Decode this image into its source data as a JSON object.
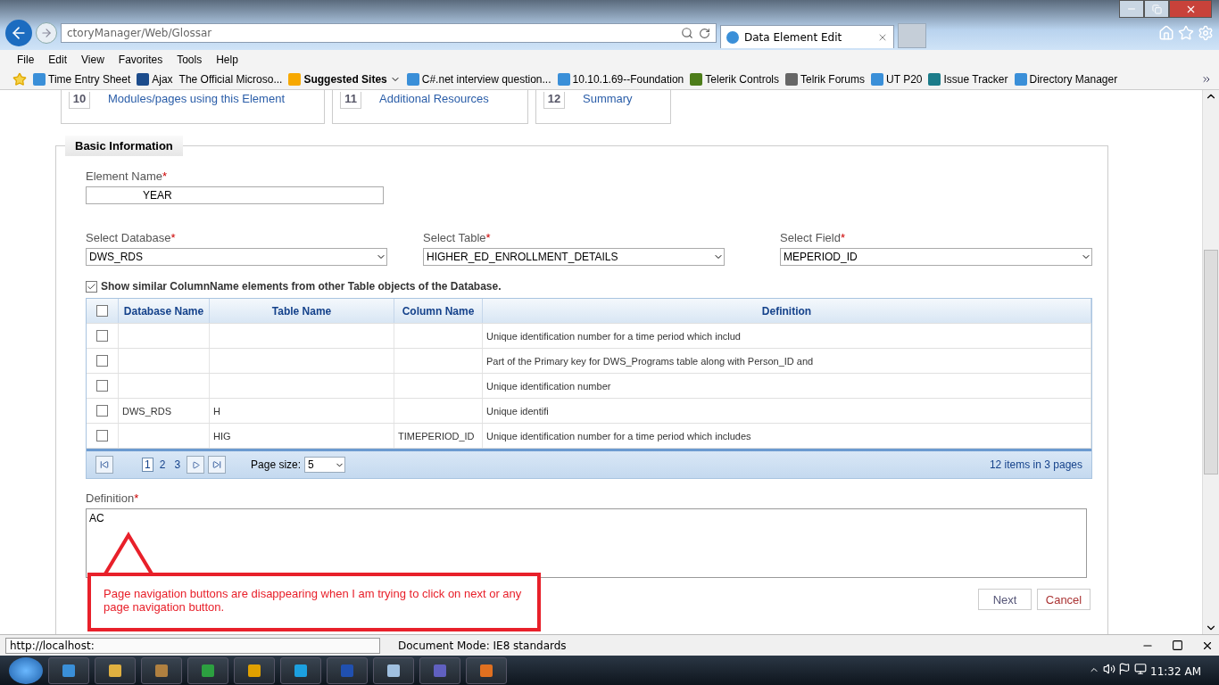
{
  "browser": {
    "address": "ctoryManager/Web/Glossar",
    "tab": {
      "title": "Data Element Edit",
      "selected": true
    },
    "menu": [
      "File",
      "Edit",
      "View",
      "Favorites",
      "Tools",
      "Help"
    ],
    "favorites": [
      {
        "label": "Time Entry Sheet",
        "kind": "page"
      },
      {
        "label": "Ajax",
        "kind": "asp"
      },
      {
        "label": "The Official Microso...",
        "kind": "plain"
      },
      {
        "label": "Suggested Sites",
        "kind": "suggested"
      },
      {
        "label": "C#.net interview question...",
        "kind": "page"
      },
      {
        "label": "10.10.1.69--Foundation",
        "kind": "page"
      },
      {
        "label": "Telerik Controls",
        "kind": "telerik"
      },
      {
        "label": "Telrik Forums",
        "kind": "forum"
      },
      {
        "label": "UT P20",
        "kind": "page"
      },
      {
        "label": "Issue Tracker",
        "kind": "tracker"
      },
      {
        "label": "Directory Manager",
        "kind": "page"
      }
    ]
  },
  "steps": [
    {
      "number": "10",
      "label": "Modules/pages using this Element"
    },
    {
      "number": "11",
      "label": "Additional Resources"
    },
    {
      "number": "12",
      "label": "Summary"
    }
  ],
  "section": "Basic Information",
  "element_name": {
    "label": "Element Name",
    "required_mark": "*",
    "value": "YEAR"
  },
  "selects": [
    {
      "label": "Select Database",
      "required_mark": "*",
      "value": "DWS_RDS"
    },
    {
      "label": "Select Table",
      "required_mark": "*",
      "value": "HIGHER_ED_ENROLLMENT_DETAILS"
    },
    {
      "label": "Select Field",
      "required_mark": "*",
      "value": "MEPERIOD_ID"
    }
  ],
  "show_similar": {
    "label": "Show similar ColumnName elements from other Table objects of the Database.",
    "checked": true
  },
  "grid": {
    "header_checked": false,
    "columns": [
      "Database Name",
      "Table Name",
      "Column Name",
      "Definition"
    ],
    "rows": [
      {
        "checked": false,
        "cells": [
          "",
          "",
          "",
          "Unique identification number for a time period which includ"
        ]
      },
      {
        "checked": false,
        "cells": [
          "",
          "",
          "",
          "Part of the Primary key for DWS_Programs table along with Person_ID and"
        ]
      },
      {
        "checked": false,
        "cells": [
          "",
          "",
          "",
          "Unique identification number"
        ]
      },
      {
        "checked": false,
        "cells": [
          "DWS_RDS",
          "H",
          "",
          "Unique identifi"
        ]
      },
      {
        "checked": false,
        "cells": [
          "",
          "HIG",
          "TIMEPERIOD_ID",
          "Unique identification number for a time period which includes"
        ]
      }
    ],
    "pages": [
      {
        "label": "1",
        "selected": true
      },
      {
        "label": "2",
        "selected": false
      },
      {
        "label": "3",
        "selected": false
      }
    ],
    "page_size_label": "Page size:",
    "page_size": "5",
    "summary": "12 items in 3 pages"
  },
  "definition": {
    "label": "Definition",
    "required_mark": "*",
    "value": "AC"
  },
  "buttons": [
    {
      "label": "Next",
      "kind": "primary"
    },
    {
      "label": "Cancel",
      "kind": "cancel"
    }
  ],
  "annotation": "Page navigation buttons are disappearing when I am trying to click on next or any page navigation button.",
  "status": {
    "url": "http://localhost:",
    "mode": "Document Mode: IE8 standards"
  },
  "clock": "11:32 AM"
}
